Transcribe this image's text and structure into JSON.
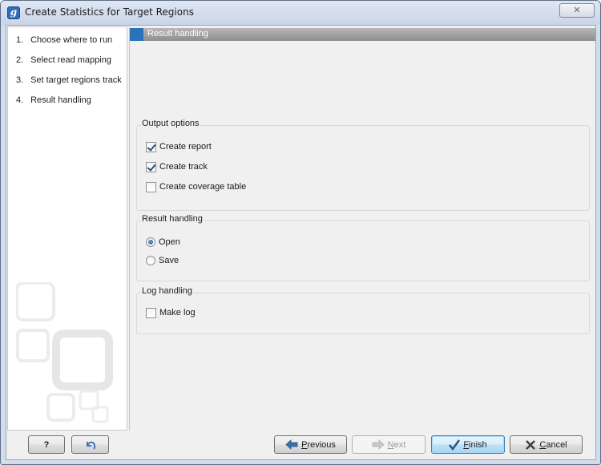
{
  "window": {
    "title": "Create Statistics for Target Regions",
    "app_icon": "g",
    "close_glyph": "✕"
  },
  "sidebar": {
    "steps": [
      {
        "num": "1.",
        "label": "Choose where to run"
      },
      {
        "num": "2.",
        "label": "Select read mapping"
      },
      {
        "num": "3.",
        "label": "Set target regions track"
      },
      {
        "num": "4.",
        "label": "Result handling"
      }
    ]
  },
  "main": {
    "header": "Result handling",
    "output_options": {
      "title": "Output options",
      "create_report": {
        "label": "Create report",
        "checked": true
      },
      "create_track": {
        "label": "Create track",
        "checked": true
      },
      "create_coverage_table": {
        "label": "Create coverage table",
        "checked": false
      }
    },
    "result_handling": {
      "title": "Result handling",
      "open": {
        "label": "Open",
        "selected": true
      },
      "save": {
        "label": "Save",
        "selected": false
      }
    },
    "log_handling": {
      "title": "Log handling",
      "make_log": {
        "label": "Make log",
        "checked": false
      }
    }
  },
  "buttons": {
    "help": "?",
    "reset_icon": "undo-arrow-icon",
    "previous_pre": "",
    "previous_u": "P",
    "previous_post": "revious",
    "next_pre": "",
    "next_u": "N",
    "next_post": "ext",
    "finish_pre": "",
    "finish_u": "F",
    "finish_post": "inish",
    "cancel_pre": "",
    "cancel_u": "C",
    "cancel_post": "ancel"
  },
  "colors": {
    "header_accent": "#2a73b8",
    "titlebar": "#dfe7f3"
  }
}
